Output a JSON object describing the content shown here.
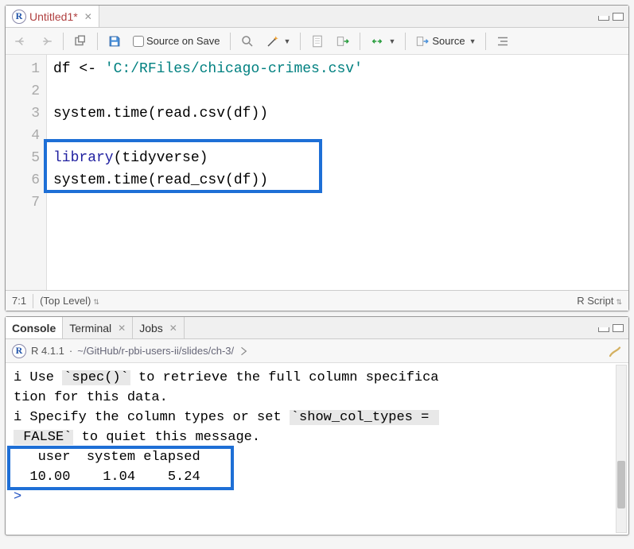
{
  "editor": {
    "tab_title": "Untitled1*",
    "source_on_save": "Source on Save",
    "source_btn": "Source",
    "lines": [
      "1",
      "2",
      "3",
      "4",
      "5",
      "6",
      "7"
    ],
    "code": {
      "l1_a": "df <- ",
      "l1_b": "'C:/RFiles/chicago-crimes.csv'",
      "l3": "system.time(read.csv(df))",
      "l5_a": "library",
      "l5_b": "(tidyverse)",
      "l6": "system.time(read_csv(df))"
    },
    "status_pos": "7:1",
    "status_scope": "(Top Level)",
    "status_lang": "R Script"
  },
  "console": {
    "tabs": {
      "console": "Console",
      "terminal": "Terminal",
      "jobs": "Jobs"
    },
    "version": "R 4.1.1",
    "path": "~/GitHub/r-pbi-users-ii/slides/ch-3/",
    "out_l1a": "i Use ",
    "out_l1b": "`spec()`",
    "out_l1c": " to retrieve the full column specifica",
    "out_l2": "tion for this data.",
    "out_l3a": "i Specify the column types or set ",
    "out_l3b": "`show_col_types = ",
    "out_l4a": " FALSE`",
    "out_l4b": " to quiet this message.",
    "out_l5": "   user  system elapsed ",
    "out_l6": "  10.00    1.04    5.24 ",
    "prompt": ">"
  }
}
